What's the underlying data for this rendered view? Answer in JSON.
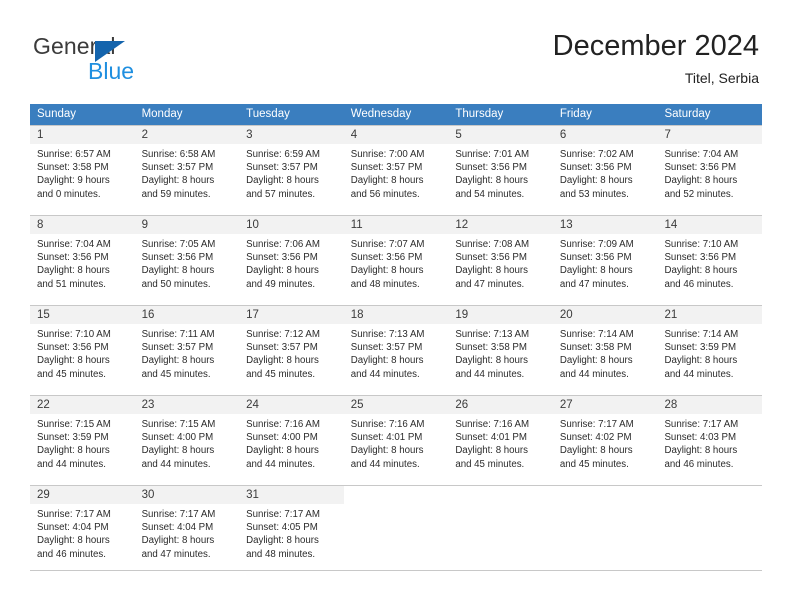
{
  "brand": {
    "name_part1": "General",
    "name_part2": "Blue",
    "triangle_color": "#1464ad",
    "blue_color": "#1f8fe0"
  },
  "header": {
    "title": "December 2024",
    "location": "Titel, Serbia"
  },
  "theme": {
    "header_bg": "#3a7ebf",
    "day_band_bg": "#f2f2f2",
    "grid_line": "#c8c8c8"
  },
  "weekdays": [
    "Sunday",
    "Monday",
    "Tuesday",
    "Wednesday",
    "Thursday",
    "Friday",
    "Saturday"
  ],
  "weeks": [
    [
      {
        "day": "1",
        "sunrise": "Sunrise: 6:57 AM",
        "sunset": "Sunset: 3:58 PM",
        "daylight1": "Daylight: 9 hours",
        "daylight2": "and 0 minutes."
      },
      {
        "day": "2",
        "sunrise": "Sunrise: 6:58 AM",
        "sunset": "Sunset: 3:57 PM",
        "daylight1": "Daylight: 8 hours",
        "daylight2": "and 59 minutes."
      },
      {
        "day": "3",
        "sunrise": "Sunrise: 6:59 AM",
        "sunset": "Sunset: 3:57 PM",
        "daylight1": "Daylight: 8 hours",
        "daylight2": "and 57 minutes."
      },
      {
        "day": "4",
        "sunrise": "Sunrise: 7:00 AM",
        "sunset": "Sunset: 3:57 PM",
        "daylight1": "Daylight: 8 hours",
        "daylight2": "and 56 minutes."
      },
      {
        "day": "5",
        "sunrise": "Sunrise: 7:01 AM",
        "sunset": "Sunset: 3:56 PM",
        "daylight1": "Daylight: 8 hours",
        "daylight2": "and 54 minutes."
      },
      {
        "day": "6",
        "sunrise": "Sunrise: 7:02 AM",
        "sunset": "Sunset: 3:56 PM",
        "daylight1": "Daylight: 8 hours",
        "daylight2": "and 53 minutes."
      },
      {
        "day": "7",
        "sunrise": "Sunrise: 7:04 AM",
        "sunset": "Sunset: 3:56 PM",
        "daylight1": "Daylight: 8 hours",
        "daylight2": "and 52 minutes."
      }
    ],
    [
      {
        "day": "8",
        "sunrise": "Sunrise: 7:04 AM",
        "sunset": "Sunset: 3:56 PM",
        "daylight1": "Daylight: 8 hours",
        "daylight2": "and 51 minutes."
      },
      {
        "day": "9",
        "sunrise": "Sunrise: 7:05 AM",
        "sunset": "Sunset: 3:56 PM",
        "daylight1": "Daylight: 8 hours",
        "daylight2": "and 50 minutes."
      },
      {
        "day": "10",
        "sunrise": "Sunrise: 7:06 AM",
        "sunset": "Sunset: 3:56 PM",
        "daylight1": "Daylight: 8 hours",
        "daylight2": "and 49 minutes."
      },
      {
        "day": "11",
        "sunrise": "Sunrise: 7:07 AM",
        "sunset": "Sunset: 3:56 PM",
        "daylight1": "Daylight: 8 hours",
        "daylight2": "and 48 minutes."
      },
      {
        "day": "12",
        "sunrise": "Sunrise: 7:08 AM",
        "sunset": "Sunset: 3:56 PM",
        "daylight1": "Daylight: 8 hours",
        "daylight2": "and 47 minutes."
      },
      {
        "day": "13",
        "sunrise": "Sunrise: 7:09 AM",
        "sunset": "Sunset: 3:56 PM",
        "daylight1": "Daylight: 8 hours",
        "daylight2": "and 47 minutes."
      },
      {
        "day": "14",
        "sunrise": "Sunrise: 7:10 AM",
        "sunset": "Sunset: 3:56 PM",
        "daylight1": "Daylight: 8 hours",
        "daylight2": "and 46 minutes."
      }
    ],
    [
      {
        "day": "15",
        "sunrise": "Sunrise: 7:10 AM",
        "sunset": "Sunset: 3:56 PM",
        "daylight1": "Daylight: 8 hours",
        "daylight2": "and 45 minutes."
      },
      {
        "day": "16",
        "sunrise": "Sunrise: 7:11 AM",
        "sunset": "Sunset: 3:57 PM",
        "daylight1": "Daylight: 8 hours",
        "daylight2": "and 45 minutes."
      },
      {
        "day": "17",
        "sunrise": "Sunrise: 7:12 AM",
        "sunset": "Sunset: 3:57 PM",
        "daylight1": "Daylight: 8 hours",
        "daylight2": "and 45 minutes."
      },
      {
        "day": "18",
        "sunrise": "Sunrise: 7:13 AM",
        "sunset": "Sunset: 3:57 PM",
        "daylight1": "Daylight: 8 hours",
        "daylight2": "and 44 minutes."
      },
      {
        "day": "19",
        "sunrise": "Sunrise: 7:13 AM",
        "sunset": "Sunset: 3:58 PM",
        "daylight1": "Daylight: 8 hours",
        "daylight2": "and 44 minutes."
      },
      {
        "day": "20",
        "sunrise": "Sunrise: 7:14 AM",
        "sunset": "Sunset: 3:58 PM",
        "daylight1": "Daylight: 8 hours",
        "daylight2": "and 44 minutes."
      },
      {
        "day": "21",
        "sunrise": "Sunrise: 7:14 AM",
        "sunset": "Sunset: 3:59 PM",
        "daylight1": "Daylight: 8 hours",
        "daylight2": "and 44 minutes."
      }
    ],
    [
      {
        "day": "22",
        "sunrise": "Sunrise: 7:15 AM",
        "sunset": "Sunset: 3:59 PM",
        "daylight1": "Daylight: 8 hours",
        "daylight2": "and 44 minutes."
      },
      {
        "day": "23",
        "sunrise": "Sunrise: 7:15 AM",
        "sunset": "Sunset: 4:00 PM",
        "daylight1": "Daylight: 8 hours",
        "daylight2": "and 44 minutes."
      },
      {
        "day": "24",
        "sunrise": "Sunrise: 7:16 AM",
        "sunset": "Sunset: 4:00 PM",
        "daylight1": "Daylight: 8 hours",
        "daylight2": "and 44 minutes."
      },
      {
        "day": "25",
        "sunrise": "Sunrise: 7:16 AM",
        "sunset": "Sunset: 4:01 PM",
        "daylight1": "Daylight: 8 hours",
        "daylight2": "and 44 minutes."
      },
      {
        "day": "26",
        "sunrise": "Sunrise: 7:16 AM",
        "sunset": "Sunset: 4:01 PM",
        "daylight1": "Daylight: 8 hours",
        "daylight2": "and 45 minutes."
      },
      {
        "day": "27",
        "sunrise": "Sunrise: 7:17 AM",
        "sunset": "Sunset: 4:02 PM",
        "daylight1": "Daylight: 8 hours",
        "daylight2": "and 45 minutes."
      },
      {
        "day": "28",
        "sunrise": "Sunrise: 7:17 AM",
        "sunset": "Sunset: 4:03 PM",
        "daylight1": "Daylight: 8 hours",
        "daylight2": "and 46 minutes."
      }
    ],
    [
      {
        "day": "29",
        "sunrise": "Sunrise: 7:17 AM",
        "sunset": "Sunset: 4:04 PM",
        "daylight1": "Daylight: 8 hours",
        "daylight2": "and 46 minutes."
      },
      {
        "day": "30",
        "sunrise": "Sunrise: 7:17 AM",
        "sunset": "Sunset: 4:04 PM",
        "daylight1": "Daylight: 8 hours",
        "daylight2": "and 47 minutes."
      },
      {
        "day": "31",
        "sunrise": "Sunrise: 7:17 AM",
        "sunset": "Sunset: 4:05 PM",
        "daylight1": "Daylight: 8 hours",
        "daylight2": "and 48 minutes."
      },
      {
        "day": "",
        "sunrise": "",
        "sunset": "",
        "daylight1": "",
        "daylight2": ""
      },
      {
        "day": "",
        "sunrise": "",
        "sunset": "",
        "daylight1": "",
        "daylight2": ""
      },
      {
        "day": "",
        "sunrise": "",
        "sunset": "",
        "daylight1": "",
        "daylight2": ""
      },
      {
        "day": "",
        "sunrise": "",
        "sunset": "",
        "daylight1": "",
        "daylight2": ""
      }
    ]
  ]
}
